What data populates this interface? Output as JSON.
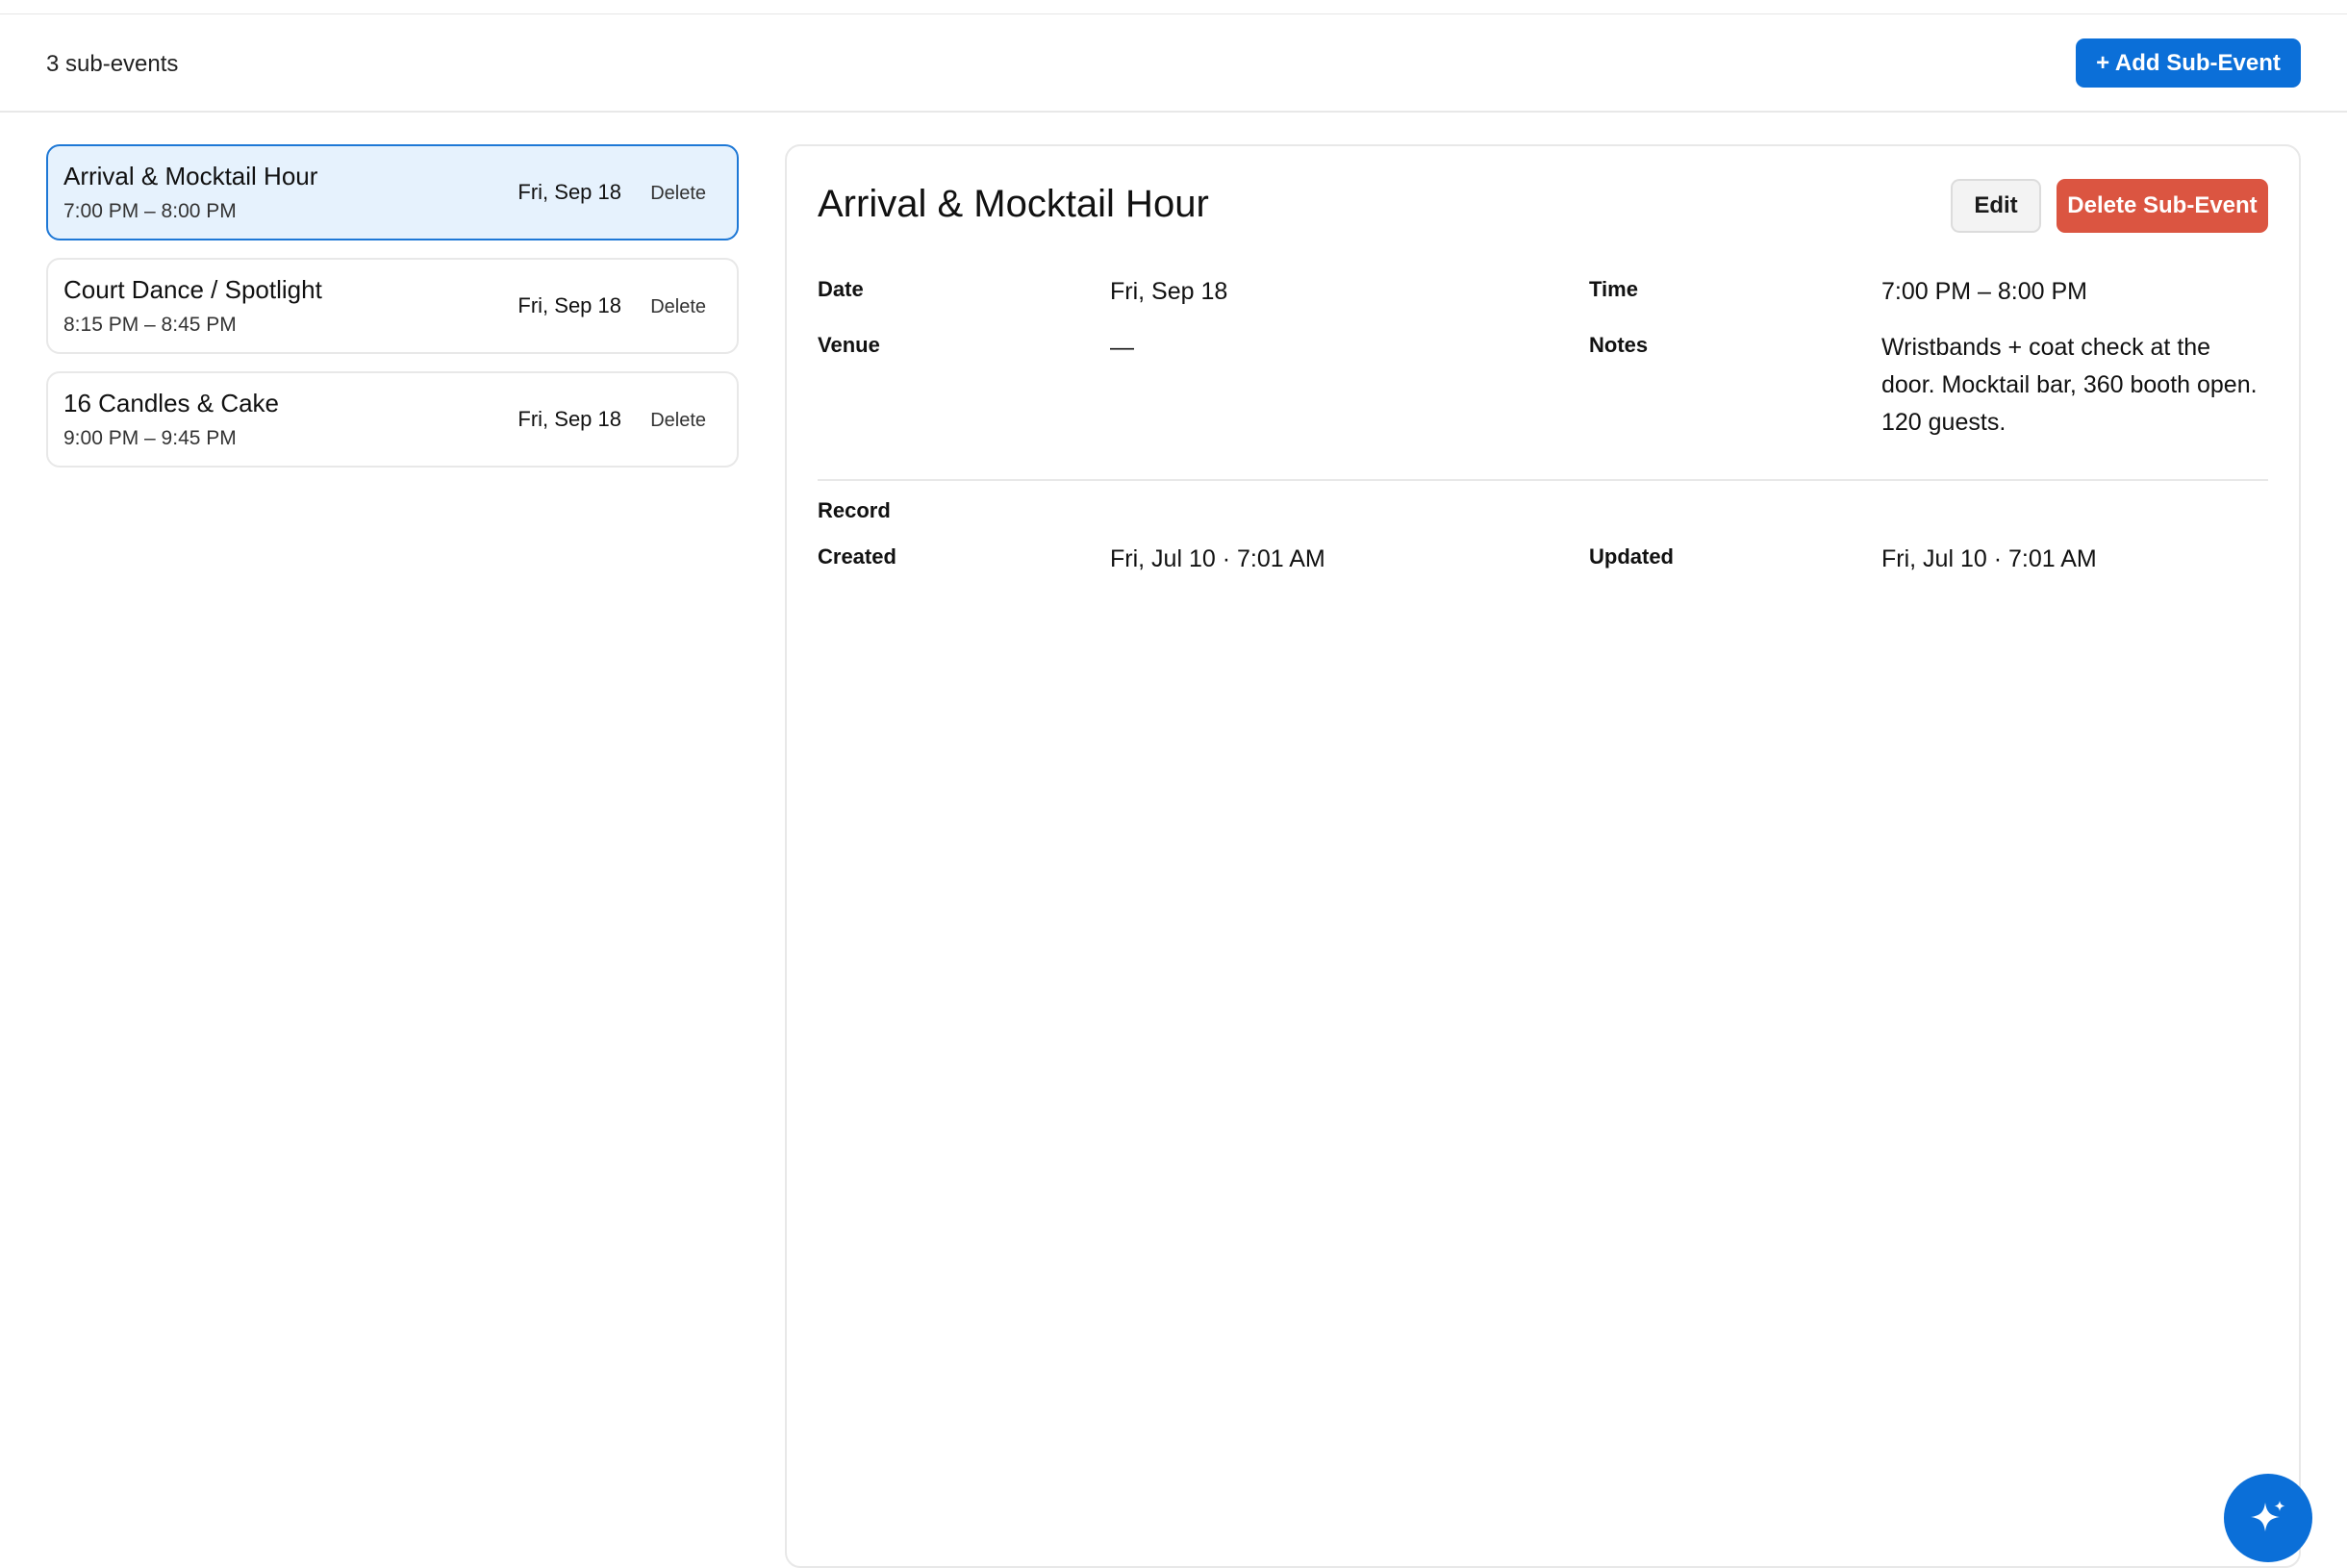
{
  "toolbar": {
    "count_text": "3 sub-events",
    "add_label": "+ Add Sub-Event"
  },
  "list": {
    "items": [
      {
        "title": "Arrival & Mocktail Hour",
        "time": "7:00 PM – 8:00 PM",
        "date": "Fri, Sep 18",
        "delete_label": "Delete",
        "selected": true
      },
      {
        "title": "Court Dance / Spotlight",
        "time": "8:15 PM – 8:45 PM",
        "date": "Fri, Sep 18",
        "delete_label": "Delete",
        "selected": false
      },
      {
        "title": "16 Candles & Cake",
        "time": "9:00 PM – 9:45 PM",
        "date": "Fri, Sep 18",
        "delete_label": "Delete",
        "selected": false
      }
    ]
  },
  "detail": {
    "title": "Arrival & Mocktail Hour",
    "edit_label": "Edit",
    "delete_label": "Delete Sub-Event",
    "fields": {
      "date_label": "Date",
      "date_value": "Fri, Sep 18",
      "time_label": "Time",
      "time_value": "7:00 PM – 8:00 PM",
      "venue_label": "Venue",
      "venue_value": "—",
      "notes_label": "Notes",
      "notes_value": "Wristbands + coat check at the door. Mocktail bar, 360 booth open. 120 guests."
    },
    "record": {
      "heading": "Record",
      "created_label": "Created",
      "created_value": "Fri, Jul 10 · 7:01 AM",
      "updated_label": "Updated",
      "updated_value": "Fri, Jul 10 · 7:01 AM"
    }
  },
  "fab": {
    "icon": "sparkle-icon"
  },
  "colors": {
    "primary": "#0b6fd8",
    "danger": "#db5541",
    "selected_bg": "#e6f2fd",
    "selected_border": "#1e78d6"
  }
}
